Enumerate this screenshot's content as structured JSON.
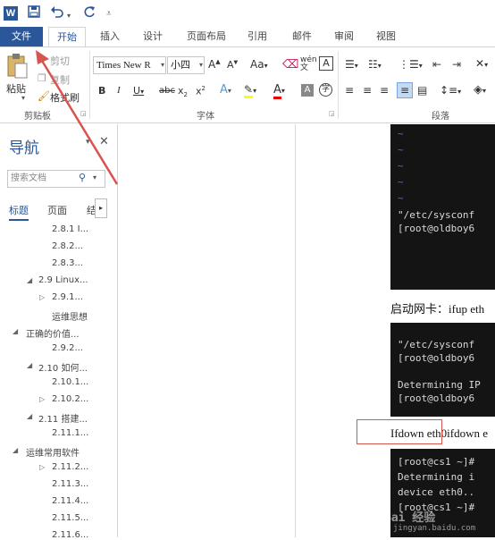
{
  "quick_access": {
    "app_icon": "word-icon",
    "app_letter": "W",
    "save_icon": "save-icon",
    "undo_icon": "undo-icon",
    "redo_icon": "redo-icon",
    "customize_icon": "customize-icon"
  },
  "tabs": [
    "文件",
    "开始",
    "插入",
    "设计",
    "页面布局",
    "引用",
    "邮件",
    "审阅",
    "视图"
  ],
  "ribbon": {
    "clipboard": {
      "paste_label": "粘贴",
      "cut_label": "剪切",
      "copy_label": "复制",
      "format_painter_label": "格式刷",
      "group_label": "剪贴板"
    },
    "font": {
      "font_name": "Times New R",
      "font_size": "小四",
      "group_label": "字体"
    },
    "paragraph": {
      "group_label": "段落"
    }
  },
  "nav": {
    "title": "导航",
    "search_placeholder": "搜索文档",
    "tabs": [
      "标题",
      "页面",
      "结"
    ],
    "items": [
      "2.8.1 I...",
      "2.8.2...",
      "2.8.3...",
      "2.9 Linux...",
      "2.9.1...",
      "运维思想",
      "正确的价值...",
      "2.9.2...",
      "2.10 如何...",
      "2.10.1...",
      "2.10.2...",
      "2.11 搭建...",
      "2.11.1...",
      "运维常用软件",
      "2.11.2...",
      "2.11.3...",
      "2.11.4...",
      "2.11.5...",
      "2.11.6..."
    ]
  },
  "document": {
    "term1_line1": "\"/etc/sysconf",
    "term1_line2": "[root@oldboy6",
    "para1": "启动网卡：ifup eth",
    "term2_line1": "\"/etc/sysconf",
    "term2_line2": "[root@oldboy6",
    "term2_line3": "Determining IP",
    "term2_line4": "[root@oldboy6",
    "para2": "Ifdown eth0ifdown e",
    "term3_line1": "[root@cs1 ~]#",
    "term3_line2": "Determining i",
    "term3_line3": "device eth0..",
    "term3_line4": "[root@cs1 ~]#",
    "watermark": "Bai 经验",
    "watermark_url": "jingyan.baidu.com"
  },
  "colors": {
    "accent": "#2b579a",
    "annotation_red": "#d9534f",
    "terminal_bg": "#141414"
  }
}
